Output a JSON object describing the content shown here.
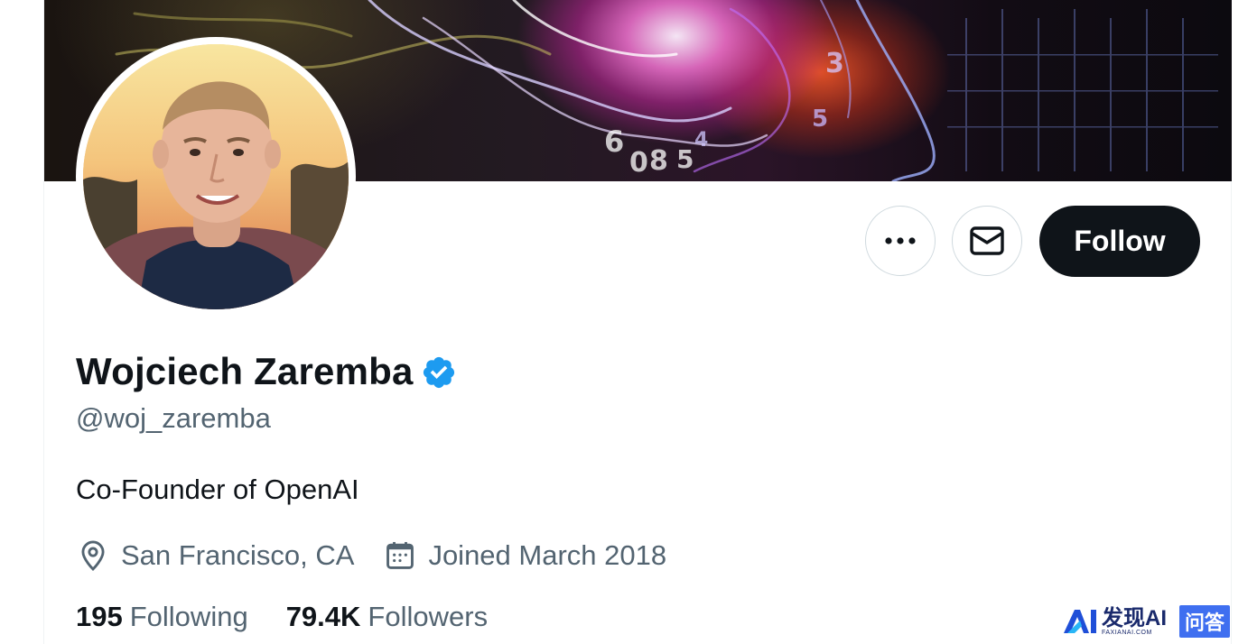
{
  "profile": {
    "display_name": "Wojciech Zaremba",
    "handle": "@woj_zaremba",
    "bio": "Co-Founder of OpenAI",
    "location": "San Francisco, CA",
    "joined": "Joined March 2018",
    "verified": true
  },
  "stats": {
    "following_count": "195",
    "following_label": "Following",
    "followers_count": "79.4K",
    "followers_label": "Followers"
  },
  "actions": {
    "follow_label": "Follow",
    "more_icon": "more-icon",
    "message_icon": "envelope-icon"
  },
  "watermark": {
    "brand": "发现AI",
    "brand_sub": "FAXIANAI.COM",
    "tag": "问答"
  },
  "colors": {
    "verified_blue": "#1d9bf0",
    "follow_bg": "#0f1419",
    "secondary_text": "#536471",
    "border": "#cfd9de"
  }
}
